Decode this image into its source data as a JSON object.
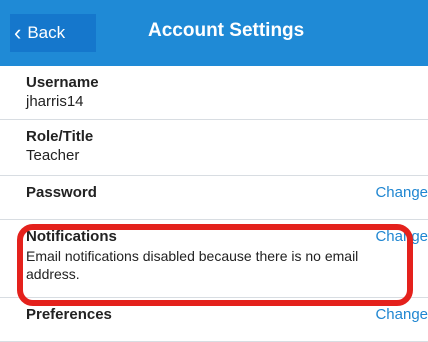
{
  "header": {
    "back_label": "Back",
    "title": "Account Settings"
  },
  "rows": [
    {
      "label": "Username",
      "value": "jharris14"
    },
    {
      "label": "Role/Title",
      "value": "Teacher"
    },
    {
      "label": "Password",
      "action": "Change"
    },
    {
      "label": "Notifications",
      "action": "Change",
      "description": "Email notifications disabled because there is no email address."
    },
    {
      "label": "Preferences",
      "action": "Change"
    }
  ],
  "colors": {
    "header": "#1f8ad6",
    "link": "#1f86d1",
    "highlight": "#e4211c"
  },
  "icons": {
    "back": "chevron-left-icon"
  }
}
